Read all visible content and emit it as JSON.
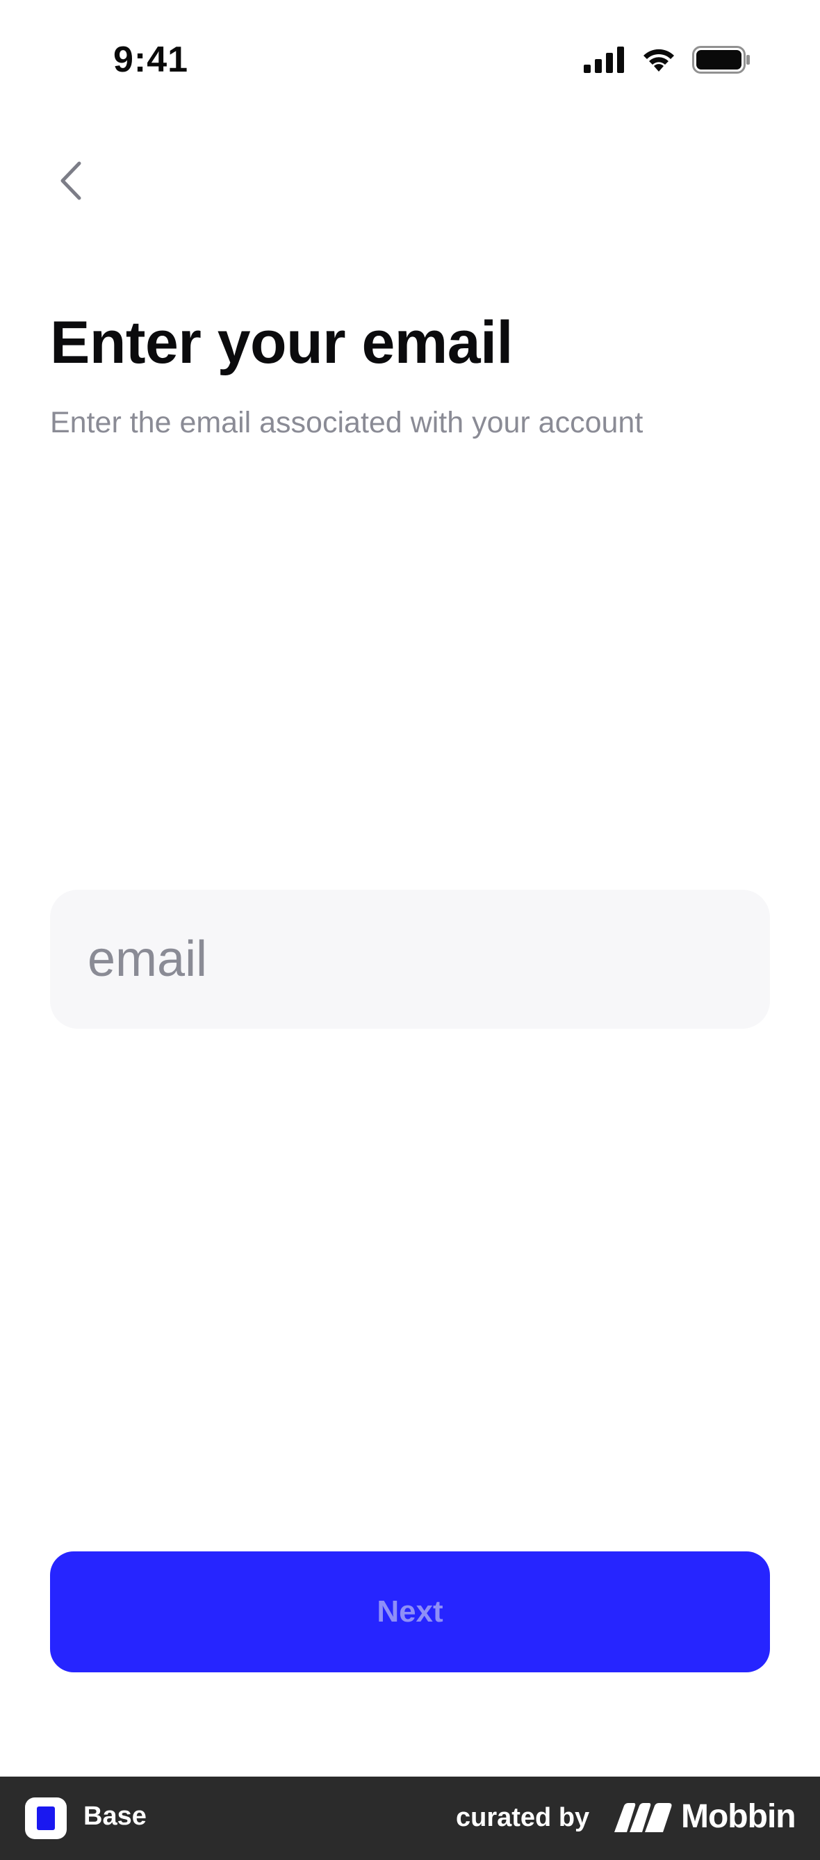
{
  "status_bar": {
    "time": "9:41",
    "icons": [
      "cellular-signal-icon",
      "wifi-icon",
      "battery-icon"
    ]
  },
  "nav": {
    "back_icon": "chevron-left-icon"
  },
  "header": {
    "title": "Enter your email",
    "subtitle": "Enter the email associated with your account"
  },
  "form": {
    "email_value": "",
    "email_placeholder": "email"
  },
  "actions": {
    "next_label": "Next"
  },
  "footer": {
    "brand_name": "Base",
    "curated_by": "curated by",
    "curator_name": "Mobbin"
  },
  "colors": {
    "accent": "#2625ff",
    "button_text": "#8e8ff7",
    "subtitle": "#8a8b95",
    "field_bg": "#f7f7f9",
    "footer_bg": "#2b2b2b"
  }
}
